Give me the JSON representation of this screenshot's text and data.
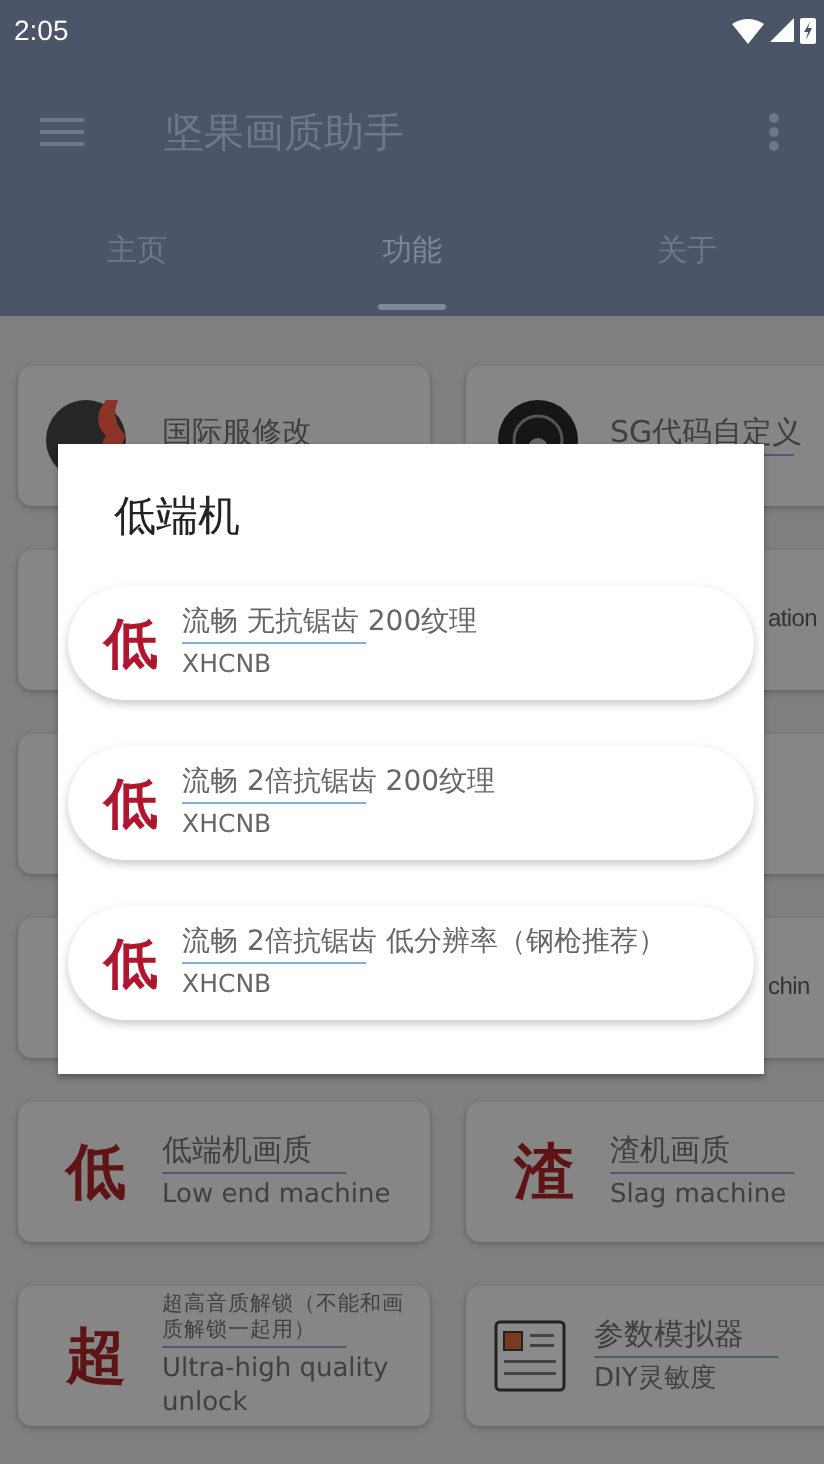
{
  "status_bar": {
    "time": "2:05"
  },
  "app_bar": {
    "title": "坚果画质助手"
  },
  "tabs": [
    {
      "label": "主页",
      "selected": false
    },
    {
      "label": "功能",
      "selected": true
    },
    {
      "label": "关于",
      "selected": false
    }
  ],
  "cards": [
    {
      "kind": "flame",
      "title": "国际服修改"
    },
    {
      "kind": "disc",
      "title": "SG代码自定义"
    },
    {
      "kind": "hidden"
    },
    {
      "kind": "hidden",
      "fragment": "ation"
    },
    {
      "kind": "hidden"
    },
    {
      "kind": "hidden"
    },
    {
      "kind": "hidden"
    },
    {
      "kind": "hidden",
      "fragment": "chin"
    },
    {
      "kind": "glyph",
      "glyph": "低",
      "title": "低端机画质",
      "subtitle": "Low end machine"
    },
    {
      "kind": "glyph",
      "glyph": "渣",
      "title": "渣机画质",
      "subtitle": "Slag machine"
    },
    {
      "kind": "glyph",
      "glyph": "超",
      "title": "超高音质解锁（不能和画质解锁一起用）",
      "subtitle": "Ultra-high quality unlock",
      "small": true
    },
    {
      "kind": "document",
      "title": "参数模拟器",
      "subtitle": "DIY灵敏度"
    }
  ],
  "dialog": {
    "title": "低端机",
    "items": [
      {
        "glyph": "低",
        "title": "流畅 无抗锯齿 200纹理",
        "subtitle": "XHCNB"
      },
      {
        "glyph": "低",
        "title": "流畅 2倍抗锯齿 200纹理",
        "subtitle": "XHCNB"
      },
      {
        "glyph": "低",
        "title": "流畅 2倍抗锯齿  低分辨率（钢枪推荐）",
        "subtitle": "XHCNB"
      }
    ]
  }
}
